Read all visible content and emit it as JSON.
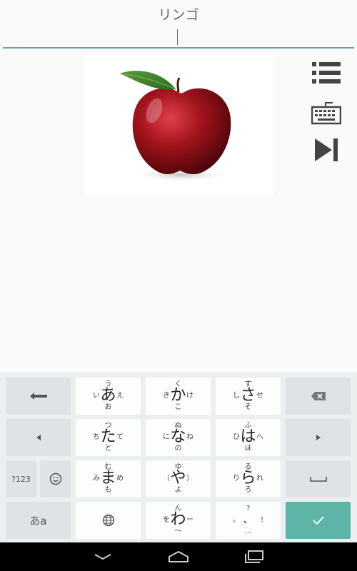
{
  "header": {
    "title": "リンゴ"
  },
  "colors": {
    "accent": "#5aa6b4",
    "confirm": "#5fb4a8",
    "apple": "#a3141d"
  },
  "side_icons": [
    "list-icon",
    "keyboard-icon",
    "skip-next-icon"
  ],
  "keyboard": {
    "layout": "japanese-flick-12-key",
    "row1": {
      "a": {
        "center": "あ",
        "up": "う",
        "left": "い",
        "right": "え",
        "down": "お"
      },
      "ka": {
        "center": "か",
        "up": "く",
        "left": "き",
        "right": "け",
        "down": "こ"
      },
      "sa": {
        "center": "さ",
        "up": "す",
        "left": "し",
        "right": "せ",
        "down": "そ"
      }
    },
    "row2": {
      "ta": {
        "center": "た",
        "up": "つ",
        "left": "ち",
        "right": "て",
        "down": "と"
      },
      "na": {
        "center": "な",
        "up": "ぬ",
        "left": "に",
        "right": "ね",
        "down": "の"
      },
      "ha": {
        "center": "は",
        "up": "ふ",
        "left": "ひ",
        "right": "へ",
        "down": "ほ"
      }
    },
    "row3": {
      "ma": {
        "center": "ま",
        "up": "む",
        "left": "み",
        "right": "め",
        "down": "も"
      },
      "ya": {
        "center": "や",
        "up": "ゆ",
        "left": "（",
        "right": "）",
        "down": "よ"
      },
      "ra": {
        "center": "ら",
        "up": "る",
        "left": "り",
        "right": "れ",
        "down": "ろ"
      }
    },
    "row4": {
      "wa": {
        "center": "わ",
        "up": "ん",
        "left": "を",
        "right": "ー",
        "down": "〜"
      },
      "punct": {
        "up": "?",
        "left": "。",
        "center": "、",
        "right": "!",
        "down": "…"
      }
    },
    "num_label": "?123",
    "mode_label": "あa"
  }
}
